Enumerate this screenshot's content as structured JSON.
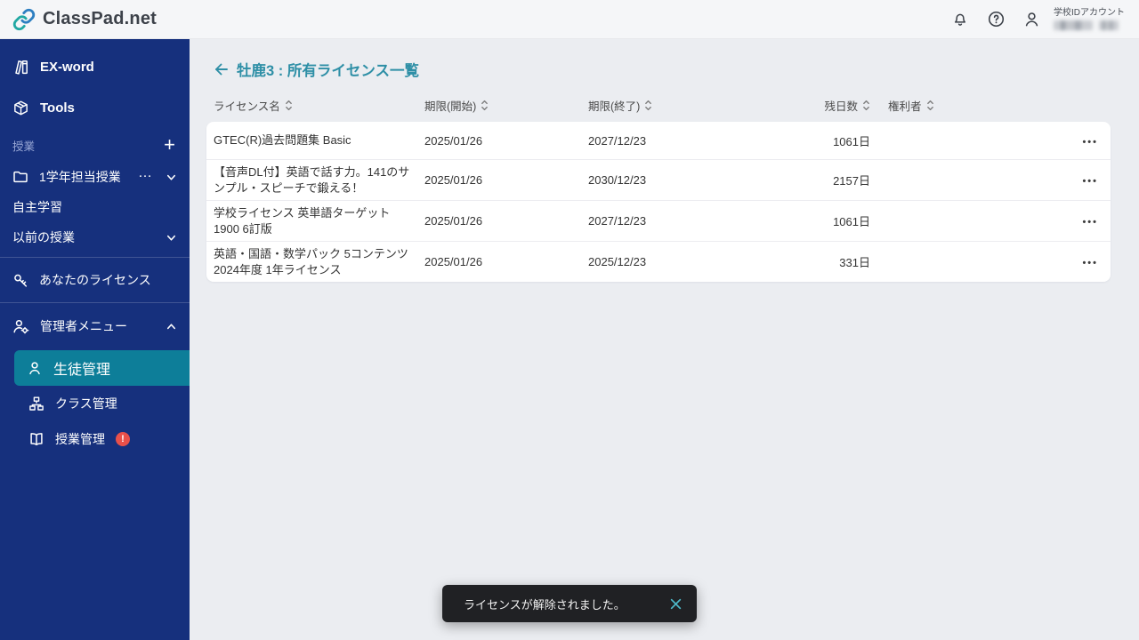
{
  "header": {
    "logo_text": "ClassPad.net",
    "account_label": "学校IDアカウント"
  },
  "sidebar": {
    "ex_word": "EX-word",
    "tools": "Tools",
    "section_label": "授業",
    "plus_glyph": "+",
    "class_item": "1学年担当授業",
    "ellipsis_glyph": "…",
    "self_study": "自主学習",
    "previous_classes": "以前の授業",
    "your_licenses": "あなたのライセンス",
    "admin_menu": "管理者メニュー",
    "student_mgmt": "生徒管理",
    "class_mgmt": "クラス管理",
    "lesson_mgmt": "授業管理",
    "badge_glyph": "!"
  },
  "main": {
    "title": "牡鹿3 : 所有ライセンス一覧",
    "table": {
      "columns": {
        "name": "ライセンス名",
        "start": "期限(開始)",
        "end": "期限(終了)",
        "days": "残日数",
        "owner": "権利者"
      },
      "rows": [
        {
          "name": "GTEC(R)過去問題集 Basic",
          "start": "2025/01/26",
          "end": "2027/12/23",
          "days": "1061日"
        },
        {
          "name": "【音声DL付】英語で話す力。141のサンプル・スピーチで鍛える！",
          "start": "2025/01/26",
          "end": "2030/12/23",
          "days": "2157日"
        },
        {
          "name": "学校ライセンス 英単語ターゲット1900 6訂版",
          "start": "2025/01/26",
          "end": "2027/12/23",
          "days": "1061日"
        },
        {
          "name": "英語・国語・数学パック 5コンテンツ 2024年度 1年ライセンス",
          "start": "2025/01/26",
          "end": "2025/12/23",
          "days": "331日"
        }
      ],
      "row_menu_glyph": "•••"
    }
  },
  "toast": {
    "message": "ライセンスが解除されました。"
  },
  "colors": {
    "sidebar_bg": "#16307d",
    "selected_bg": "#0d7e99",
    "title_teal": "#2e8fa6",
    "badge_red": "#e8504a",
    "toast_bg": "#202124",
    "toast_close": "#4db8c8",
    "logo_teal": "#21a8a3",
    "logo_blue": "#2d7fc1"
  }
}
